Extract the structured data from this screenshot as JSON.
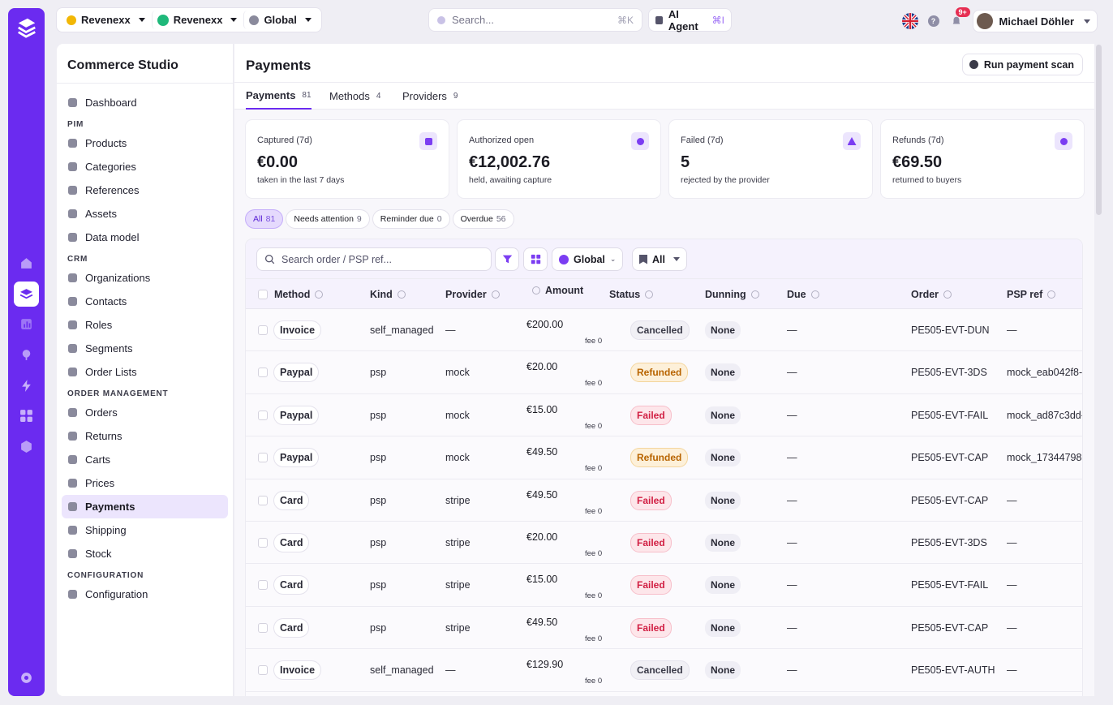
{
  "topbar": {
    "context": [
      {
        "label": "Revenexx",
        "icon": "brand-icon",
        "color": "#f2b705"
      },
      {
        "label": "Revenexx",
        "icon": "channel-dot",
        "color": "#1fb87a"
      },
      {
        "label": "Global",
        "icon": "globe-icon",
        "color": "#7a7a8c"
      }
    ],
    "search": {
      "placeholder": "Search...",
      "shortcut": "⌘K"
    },
    "ai_agent": {
      "label": "AI Agent",
      "shortcut": "⌘I"
    },
    "notifications_badge": "9+",
    "user_name": "Michael Döhler"
  },
  "sidebar": {
    "title": "Commerce Studio",
    "sections": [
      {
        "group": "",
        "items": [
          {
            "label": "Dashboard"
          }
        ]
      },
      {
        "group": "PIM",
        "items": [
          {
            "label": "Products"
          },
          {
            "label": "Categories"
          },
          {
            "label": "References"
          },
          {
            "label": "Assets"
          },
          {
            "label": "Data model"
          }
        ]
      },
      {
        "group": "CRM",
        "items": [
          {
            "label": "Organizations"
          },
          {
            "label": "Contacts"
          },
          {
            "label": "Roles"
          },
          {
            "label": "Segments"
          },
          {
            "label": "Order Lists"
          }
        ]
      },
      {
        "group": "ORDER MANAGEMENT",
        "items": [
          {
            "label": "Orders"
          },
          {
            "label": "Returns"
          },
          {
            "label": "Carts"
          },
          {
            "label": "Prices"
          },
          {
            "label": "Payments",
            "active": true
          },
          {
            "label": "Shipping"
          },
          {
            "label": "Stock"
          }
        ]
      },
      {
        "group": "CONFIGURATION",
        "items": [
          {
            "label": "Configuration"
          }
        ]
      }
    ]
  },
  "main": {
    "title": "Payments",
    "scan_button": "Run payment scan",
    "tabs": [
      {
        "label": "Payments",
        "count": "81",
        "active": true
      },
      {
        "label": "Methods",
        "count": "4"
      },
      {
        "label": "Providers",
        "count": "9"
      }
    ],
    "cards": [
      {
        "label": "Captured (7d)",
        "value": "€0.00",
        "sub": "taken in the last 7 days"
      },
      {
        "label": "Authorized open",
        "value": "€12,002.76",
        "sub": "held, awaiting capture"
      },
      {
        "label": "Failed (7d)",
        "value": "5",
        "sub": "rejected by the provider"
      },
      {
        "label": "Refunds (7d)",
        "value": "€69.50",
        "sub": "returned to buyers"
      }
    ],
    "chips": [
      {
        "label": "All",
        "count": "81",
        "active": true
      },
      {
        "label": "Needs attention",
        "count": "9"
      },
      {
        "label": "Reminder due",
        "count": "0"
      },
      {
        "label": "Overdue",
        "count": "56"
      }
    ],
    "toolbar": {
      "search_placeholder": "Search order / PSP ref...",
      "scope": "Global",
      "list": "All"
    },
    "columns": [
      "Method",
      "Kind",
      "Provider",
      "Amount",
      "Status",
      "Dunning",
      "Due",
      "Order",
      "PSP ref"
    ],
    "rows": [
      {
        "method": "Invoice",
        "kind": "self_managed",
        "provider": "—",
        "amount": "€200.00",
        "fee": "fee 0",
        "status": "Cancelled",
        "dunning": "None",
        "due": "—",
        "order": "PE505-EVT-DUN",
        "psp": "—"
      },
      {
        "method": "Paypal",
        "kind": "psp",
        "provider": "mock",
        "amount": "€20.00",
        "fee": "fee 0",
        "status": "Refunded",
        "dunning": "None",
        "due": "—",
        "order": "PE505-EVT-3DS",
        "psp": "mock_eab042f8-"
      },
      {
        "method": "Paypal",
        "kind": "psp",
        "provider": "mock",
        "amount": "€15.00",
        "fee": "fee 0",
        "status": "Failed",
        "dunning": "None",
        "due": "—",
        "order": "PE505-EVT-FAIL",
        "psp": "mock_ad87c3dd-"
      },
      {
        "method": "Paypal",
        "kind": "psp",
        "provider": "mock",
        "amount": "€49.50",
        "fee": "fee 0",
        "status": "Refunded",
        "dunning": "None",
        "due": "—",
        "order": "PE505-EVT-CAP",
        "psp": "mock_17344798-"
      },
      {
        "method": "Card",
        "kind": "psp",
        "provider": "stripe",
        "amount": "€49.50",
        "fee": "fee 0",
        "status": "Failed",
        "dunning": "None",
        "due": "—",
        "order": "PE505-EVT-CAP",
        "psp": "—"
      },
      {
        "method": "Card",
        "kind": "psp",
        "provider": "stripe",
        "amount": "€20.00",
        "fee": "fee 0",
        "status": "Failed",
        "dunning": "None",
        "due": "—",
        "order": "PE505-EVT-3DS",
        "psp": "—"
      },
      {
        "method": "Card",
        "kind": "psp",
        "provider": "stripe",
        "amount": "€15.00",
        "fee": "fee 0",
        "status": "Failed",
        "dunning": "None",
        "due": "—",
        "order": "PE505-EVT-FAIL",
        "psp": "—"
      },
      {
        "method": "Card",
        "kind": "psp",
        "provider": "stripe",
        "amount": "€49.50",
        "fee": "fee 0",
        "status": "Failed",
        "dunning": "None",
        "due": "—",
        "order": "PE505-EVT-CAP",
        "psp": "—"
      },
      {
        "method": "Invoice",
        "kind": "self_managed",
        "provider": "—",
        "amount": "€129.90",
        "fee": "fee 0",
        "status": "Cancelled",
        "dunning": "None",
        "due": "—",
        "order": "PE505-EVT-AUTH",
        "psp": "—"
      }
    ]
  },
  "colors": {
    "accent": "#6b2bf0",
    "failed": "#d11f43",
    "refunded": "#b86400"
  }
}
